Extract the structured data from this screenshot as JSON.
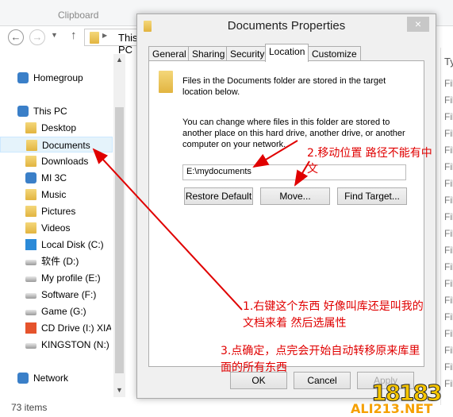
{
  "ribbon": {
    "group_label": "Clipboard"
  },
  "address": {
    "crumb": "This PC"
  },
  "sidebar": {
    "items": [
      {
        "label": "Homegroup",
        "icon": "homegroup-icon"
      },
      {
        "label": "This PC",
        "icon": "computer-icon"
      },
      {
        "label": "Desktop",
        "icon": "desktop-folder-icon"
      },
      {
        "label": "Documents",
        "icon": "documents-folder-icon",
        "selected": true
      },
      {
        "label": "Downloads",
        "icon": "downloads-folder-icon"
      },
      {
        "label": "MI 3C",
        "icon": "phone-icon"
      },
      {
        "label": "Music",
        "icon": "music-folder-icon"
      },
      {
        "label": "Pictures",
        "icon": "pictures-folder-icon"
      },
      {
        "label": "Videos",
        "icon": "videos-folder-icon"
      },
      {
        "label": "Local Disk (C:)",
        "icon": "system-drive-icon"
      },
      {
        "label": "软件 (D:)",
        "icon": "drive-icon"
      },
      {
        "label": "My profile (E:)",
        "icon": "drive-icon"
      },
      {
        "label": "Software (F:)",
        "icon": "drive-icon"
      },
      {
        "label": "Game (G:)",
        "icon": "drive-icon"
      },
      {
        "label": "CD Drive (I:) XIAO",
        "icon": "mi-drive-icon"
      },
      {
        "label": "KINGSTON (N:)",
        "icon": "usb-drive-icon"
      },
      {
        "label": "Network",
        "icon": "network-icon"
      }
    ]
  },
  "status": {
    "items": "73 items"
  },
  "list": {
    "type_header": "Ty",
    "row_text": "Fil"
  },
  "dialog": {
    "title": "Documents Properties",
    "close": "×",
    "tabs": [
      "General",
      "Sharing",
      "Security",
      "Location",
      "Customize"
    ],
    "active_tab": "Location",
    "desc1": "Files in the Documents folder are stored in the target location below.",
    "desc2": "You can change where files in this folder are stored to another place on this hard drive, another drive, or another computer on your network.",
    "path_value": "E:\\mydocuments",
    "restore": "Restore Default",
    "move": "Move...",
    "find": "Find Target...",
    "ok": "OK",
    "cancel": "Cancel",
    "apply": "Apply"
  },
  "annotations": {
    "note1": "1.右键这个东西 好像叫库还是叫我的",
    "note1b": "文档来着  然后选属性",
    "note2": "2.移动位置 路径不能有中",
    "note2b": "文",
    "note3": "3.点确定，点完会开始自动转移原来库里",
    "note3b": "面的所有东西",
    "color": "#e00000"
  },
  "watermark": {
    "text": "18183",
    "site": "ALI213.NET"
  }
}
